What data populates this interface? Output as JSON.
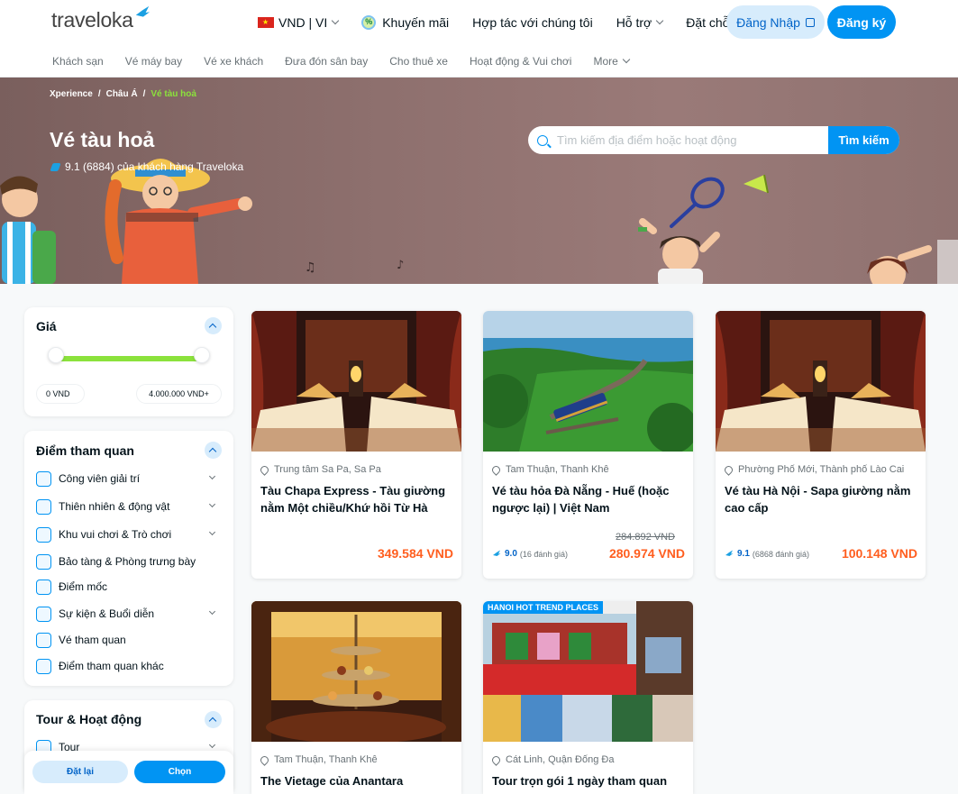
{
  "header": {
    "logo": "traveloka",
    "currency": "VND | VI",
    "promo": "Khuyến mãi",
    "partner": "Hợp tác với chúng tôi",
    "support": "Hỗ trợ",
    "bookings": "Đặt chỗ của tôi",
    "login": "Đăng Nhập",
    "register": "Đăng ký"
  },
  "subnav": [
    "Khách sạn",
    "Vé máy bay",
    "Vé xe khách",
    "Đưa đón sân bay",
    "Cho thuê xe",
    "Hoạt động & Vui chơi",
    "More"
  ],
  "hero": {
    "breadcrumb": [
      "Xperience",
      "/",
      "Châu Á",
      "/",
      "Vé tàu hoả"
    ],
    "title": "Vé tàu hoả",
    "rating": "9.1 (6884) của khách hàng Traveloka",
    "search_placeholder": "Tìm kiếm địa điểm hoặc hoạt động",
    "search_button": "Tìm kiếm"
  },
  "filters": {
    "price": {
      "title": "Giá",
      "min": "0 VND",
      "max": "4.000.000 VND+"
    },
    "attractions": {
      "title": "Điểm tham quan",
      "items": [
        {
          "label": "Công viên giải trí",
          "expandable": true
        },
        {
          "label": "Thiên nhiên & động vật",
          "expandable": true
        },
        {
          "label": "Khu vui chơi & Trò chơi",
          "expandable": true
        },
        {
          "label": "Bảo tàng & Phòng trưng bày",
          "expandable": false
        },
        {
          "label": "Điểm mốc",
          "expandable": false
        },
        {
          "label": "Sự kiện & Buổi diễn",
          "expandable": true
        },
        {
          "label": "Vé tham quan",
          "expandable": false
        },
        {
          "label": "Điểm tham quan khác",
          "expandable": false
        }
      ]
    },
    "tours": {
      "title": "Tour & Hoạt động",
      "items": [
        {
          "label": "Tour",
          "expandable": true
        }
      ]
    },
    "reset": "Đặt lại",
    "apply": "Chọn"
  },
  "cards": [
    {
      "location": "Trung tâm Sa Pa, Sa Pa",
      "title": "Tàu Chapa Express - Tàu giường nằm Một chiều/Khứ hồi Từ Hà Nộ...",
      "price": "349.584 VND",
      "old_price": "",
      "score": "",
      "reviews": ""
    },
    {
      "location": "Tam Thuận, Thanh Khê",
      "title": "Vé tàu hỏa Đà Nẵng - Huế (hoặc ngược lại) | Việt Nam",
      "price": "280.974 VND",
      "old_price": "284.892 VND",
      "score": "9.0",
      "reviews": "(16 đánh giá)"
    },
    {
      "location": "Phường Phố Mới, Thành phố Lào Cai",
      "title": "Vé tàu Hà Nội - Sapa giường nằm cao cấp",
      "price": "100.148 VND",
      "old_price": "",
      "score": "9.1",
      "reviews": "(6868 đánh giá)"
    },
    {
      "location": "Tam Thuận, Thanh Khê",
      "title": "The Vietage của Anantara",
      "price": "",
      "old_price": "",
      "score": "",
      "reviews": ""
    },
    {
      "location": "Cát Linh, Quận Đống Đa",
      "title": "Tour trọn gói 1 ngày tham quan",
      "price": "",
      "old_price": "",
      "score": "",
      "reviews": "",
      "tag": "HANOI HOT TREND PLACES"
    }
  ],
  "colors": {
    "brand": "#0194f3",
    "price": "#ff5e1f",
    "accent_green": "#8be23c"
  }
}
